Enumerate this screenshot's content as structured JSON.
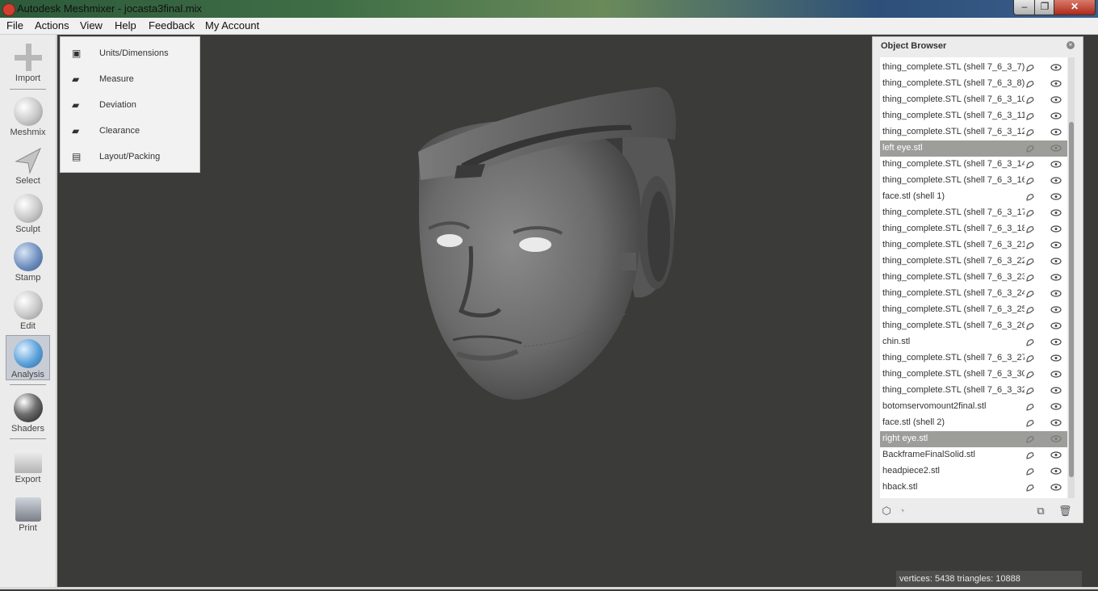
{
  "window": {
    "title": "Autodesk Meshmixer - jocasta3final.mix",
    "min_label": "–",
    "max_label": "❐",
    "close_label": "✕"
  },
  "menu": [
    "File",
    "Actions",
    "View",
    "Help",
    "Feedback",
    "My Account"
  ],
  "tools": [
    {
      "label": "Import",
      "icon": "plus-icon"
    },
    {
      "label": "Meshmix",
      "icon": "bunny-head-icon"
    },
    {
      "label": "Select",
      "icon": "arrow-cursor-icon"
    },
    {
      "label": "Sculpt",
      "icon": "brush-icon"
    },
    {
      "label": "Stamp",
      "icon": "stamp-icon"
    },
    {
      "label": "Edit",
      "icon": "edit-sphere-icon"
    },
    {
      "label": "Analysis",
      "icon": "analysis-sphere-icon",
      "active": true
    },
    {
      "label": "Shaders",
      "icon": "shader-sphere-icon"
    },
    {
      "label": "Export",
      "icon": "export-icon"
    },
    {
      "label": "Print",
      "icon": "printer-icon"
    }
  ],
  "analysis_menu": [
    {
      "label": "Units/Dimensions",
      "icon": "units-icon"
    },
    {
      "label": "Measure",
      "icon": "ruler-icon"
    },
    {
      "label": "Deviation",
      "icon": "ruler-icon"
    },
    {
      "label": "Clearance",
      "icon": "ruler-icon"
    },
    {
      "label": "Layout/Packing",
      "icon": "layout-icon"
    }
  ],
  "object_browser": {
    "title": "Object Browser",
    "items": [
      {
        "name": "thing_complete.STL (shell 7_6_3_7)",
        "selected": false
      },
      {
        "name": "thing_complete.STL (shell 7_6_3_8)",
        "selected": false
      },
      {
        "name": "thing_complete.STL (shell 7_6_3_10)",
        "selected": false
      },
      {
        "name": "thing_complete.STL (shell 7_6_3_11)",
        "selected": false
      },
      {
        "name": "thing_complete.STL (shell 7_6_3_12)",
        "selected": false
      },
      {
        "name": "left eye.stl",
        "selected": true
      },
      {
        "name": "thing_complete.STL (shell 7_6_3_14)",
        "selected": false
      },
      {
        "name": "thing_complete.STL (shell 7_6_3_16)",
        "selected": false
      },
      {
        "name": "face.stl (shell 1)",
        "selected": false
      },
      {
        "name": "thing_complete.STL (shell 7_6_3_17)",
        "selected": false
      },
      {
        "name": "thing_complete.STL (shell 7_6_3_18)",
        "selected": false
      },
      {
        "name": "thing_complete.STL (shell 7_6_3_21)",
        "selected": false
      },
      {
        "name": "thing_complete.STL (shell 7_6_3_22)",
        "selected": false
      },
      {
        "name": "thing_complete.STL (shell 7_6_3_23)",
        "selected": false
      },
      {
        "name": "thing_complete.STL (shell 7_6_3_24)",
        "selected": false
      },
      {
        "name": "thing_complete.STL (shell 7_6_3_25)",
        "selected": false
      },
      {
        "name": "thing_complete.STL (shell 7_6_3_26)",
        "selected": false
      },
      {
        "name": "chin.stl",
        "selected": false
      },
      {
        "name": "thing_complete.STL (shell 7_6_3_27)",
        "selected": false
      },
      {
        "name": "thing_complete.STL (shell 7_6_3_30)",
        "selected": false
      },
      {
        "name": "thing_complete.STL (shell 7_6_3_32)",
        "selected": false
      },
      {
        "name": "botomservomount2final.stl",
        "selected": false
      },
      {
        "name": "face.stl (shell 2)",
        "selected": false
      },
      {
        "name": "right eye.stl",
        "selected": true
      },
      {
        "name": "BackframeFinalSolid.stl",
        "selected": false
      },
      {
        "name": "headpiece2.stl",
        "selected": false
      },
      {
        "name": "hback.stl",
        "selected": false
      }
    ]
  },
  "status": "vertices: 5438 triangles: 10888"
}
